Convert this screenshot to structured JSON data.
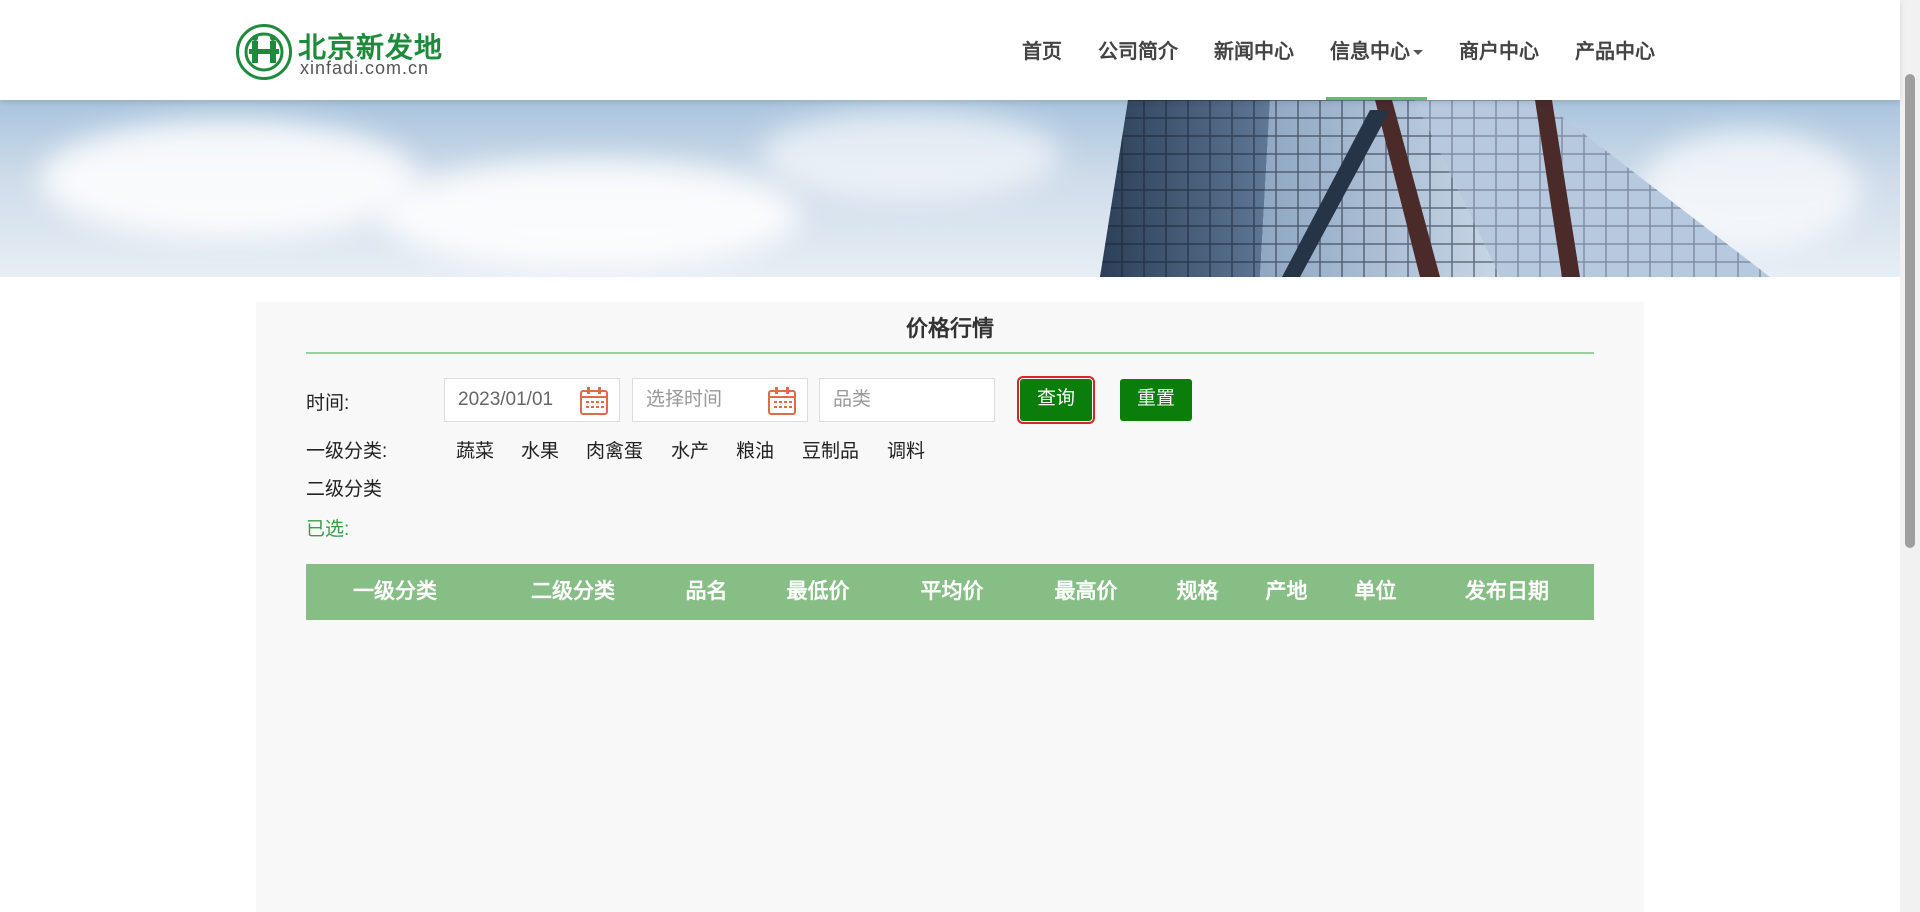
{
  "logo": {
    "name_cn": "北京新发地",
    "domain": "xinfadi.com.cn"
  },
  "nav": {
    "items": [
      {
        "label": "首页"
      },
      {
        "label": "公司简介"
      },
      {
        "label": "新闻中心"
      },
      {
        "label": "信息中心"
      },
      {
        "label": "商户中心"
      },
      {
        "label": "产品中心"
      }
    ],
    "active": "信息中心"
  },
  "panel": {
    "title": "价格行情",
    "time_label": "时间:",
    "start_date_value": "2023/01/01",
    "end_date_placeholder": "选择时间",
    "category_placeholder": "品类",
    "query_button": "查询",
    "reset_button": "重置",
    "primary_category_label": "一级分类:",
    "primary_categories": [
      "蔬菜",
      "水果",
      "肉禽蛋",
      "水产",
      "粮油",
      "豆制品",
      "调料"
    ],
    "secondary_category_label": "二级分类",
    "selected_label": "已选:"
  },
  "table": {
    "columns": [
      "一级分类",
      "二级分类",
      "品名",
      "最低价",
      "平均价",
      "最高价",
      "规格",
      "产地",
      "单位",
      "发布日期"
    ],
    "rows": []
  },
  "colors": {
    "brand_green": "#1e8a3c",
    "button_green": "#0a7d0a",
    "table_header": "#86be86",
    "focus_outline": "#d9242a",
    "calendar_icon": "#e06b4a"
  },
  "icons": {
    "calendar": "calendar-icon",
    "dropdown": "caret-down-icon"
  }
}
